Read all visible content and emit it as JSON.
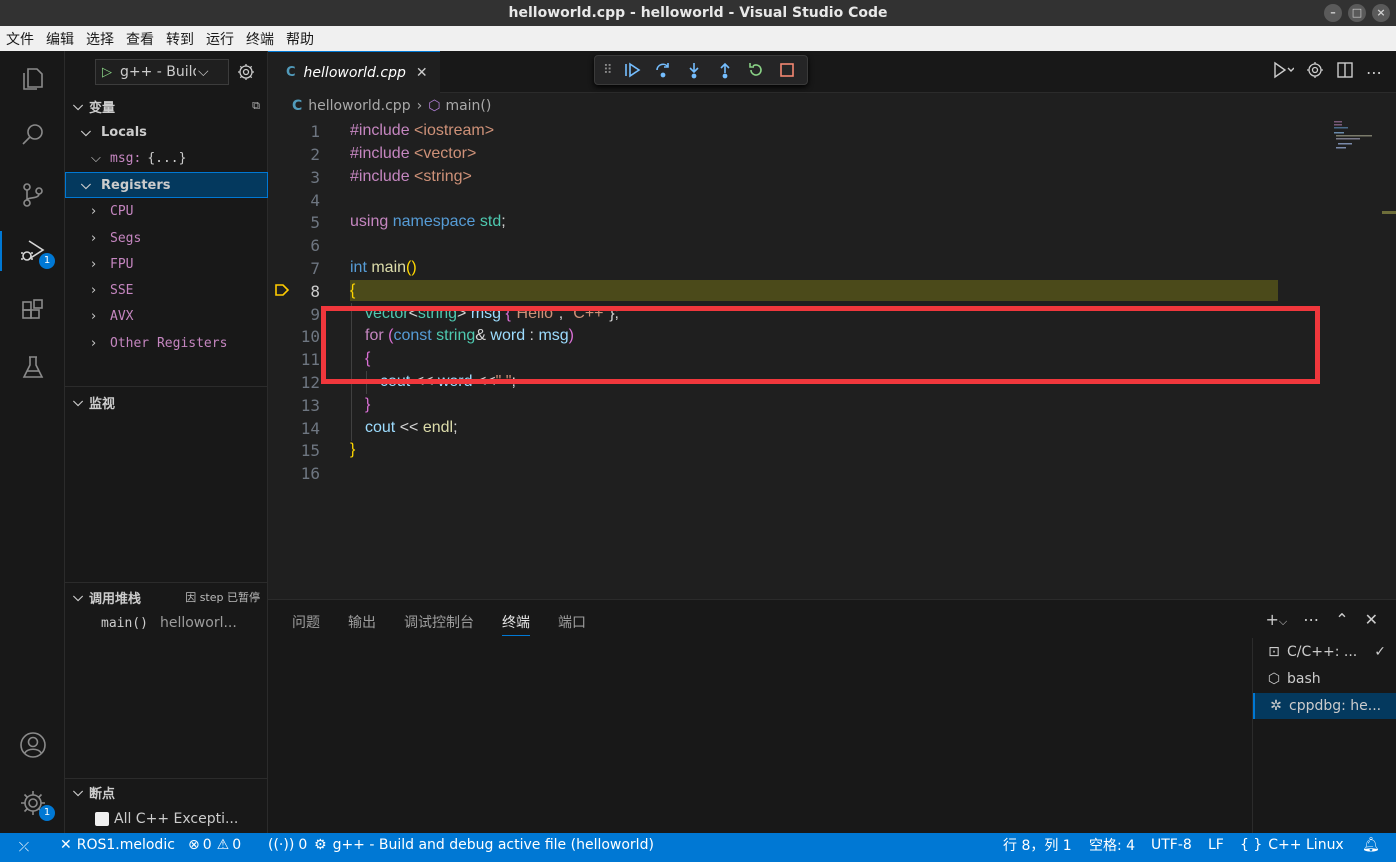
{
  "window": {
    "title": "helloworld.cpp - helloworld - Visual Studio Code",
    "controls": [
      "–",
      "□",
      "×"
    ]
  },
  "menu": [
    "文件",
    "编辑",
    "选择",
    "查看",
    "转到",
    "运行",
    "终端",
    "帮助"
  ],
  "activity_bar": {
    "icons": [
      "explorer-icon",
      "search-icon",
      "source-control-icon",
      "run-debug-icon",
      "extensions-icon",
      "testing-icon",
      "account-icon",
      "manage-gear-icon"
    ],
    "debug_badge": "1",
    "manage_badge": "1"
  },
  "sidebar": {
    "run_config": "g++ - Build and debug active file",
    "variables_title": "变量",
    "locals_label": "Locals",
    "msg_var": "msg:",
    "msg_value": "{...}",
    "registers_label": "Registers",
    "registers": [
      "CPU",
      "Segs",
      "FPU",
      "SSE",
      "AVX",
      "Other Registers"
    ],
    "watch_title": "监视",
    "callstack_title": "调用堆栈",
    "callstack_status": "因 step 已暂停",
    "frame_fn": "main()",
    "frame_file": "helloworl...",
    "breakpoints_title": "断点",
    "breakpoint_item": "All C++ Excepti..."
  },
  "editor": {
    "tab_label": "helloworld.cpp",
    "tab_icon": "C",
    "breadcrumb_file": "helloworld.cpp",
    "breadcrumb_symbol": "main()",
    "line_numbers": [
      "1",
      "2",
      "3",
      "4",
      "5",
      "6",
      "7",
      "8",
      "9",
      "10",
      "11",
      "12",
      "13",
      "14",
      "15",
      "16"
    ],
    "current_line": 8,
    "lines": {
      "l1a": "#include",
      "l1b": " <iostream>",
      "l2a": "#include",
      "l2b": " <vector>",
      "l3a": "#include",
      "l3b": " <string>",
      "l5a": "using",
      "l5b": " namespace",
      "l5c": " std",
      "l5d": ";",
      "l7a": "int",
      "l7b": " main",
      "l7c": "()",
      "l8a": "{",
      "l9a": "vector",
      "l9b": "<",
      "l9c": "string",
      "l9d": "> ",
      "l9e": "msg",
      "l9f": " {",
      "l9g": "\"Hello\"",
      "l9h": ", ",
      "l9i": "\"C++\"",
      "l9j": "};",
      "l10a": "for",
      "l10b": " (",
      "l10c": "const",
      "l10d": " string",
      "l10e": "& ",
      "l10f": "word",
      "l10g": " : ",
      "l10h": "msg",
      "l10i": ")",
      "l11a": "{",
      "l12a": "cout",
      "l12b": " << ",
      "l12c": "word",
      "l12d": " <<",
      "l12e": "\" \"",
      "l12f": ";",
      "l13a": "}",
      "l14a": "cout",
      "l14b": " << ",
      "l14c": "endl",
      "l14d": ";",
      "l15a": "}"
    }
  },
  "panel": {
    "tabs": [
      "问题",
      "输出",
      "调试控制台",
      "终端",
      "端口"
    ],
    "active_tab": "终端",
    "terminals": [
      "C/C++: ...",
      "bash",
      "cppdbg: he..."
    ]
  },
  "statusbar": {
    "ros": "ROS1.melodic",
    "errors": "0",
    "warnings": "0",
    "ports": "0",
    "debug_target": "g++ - Build and debug active file (helloworld)",
    "position": "行 8，列 1",
    "spaces": "空格: 4",
    "encoding": "UTF-8",
    "eol": "LF",
    "language": "C++",
    "os": "Linux"
  },
  "colors": {
    "accent": "#0078d4",
    "current_line_bg": "#4b4a1a",
    "annotation_box": "#f0373c"
  }
}
